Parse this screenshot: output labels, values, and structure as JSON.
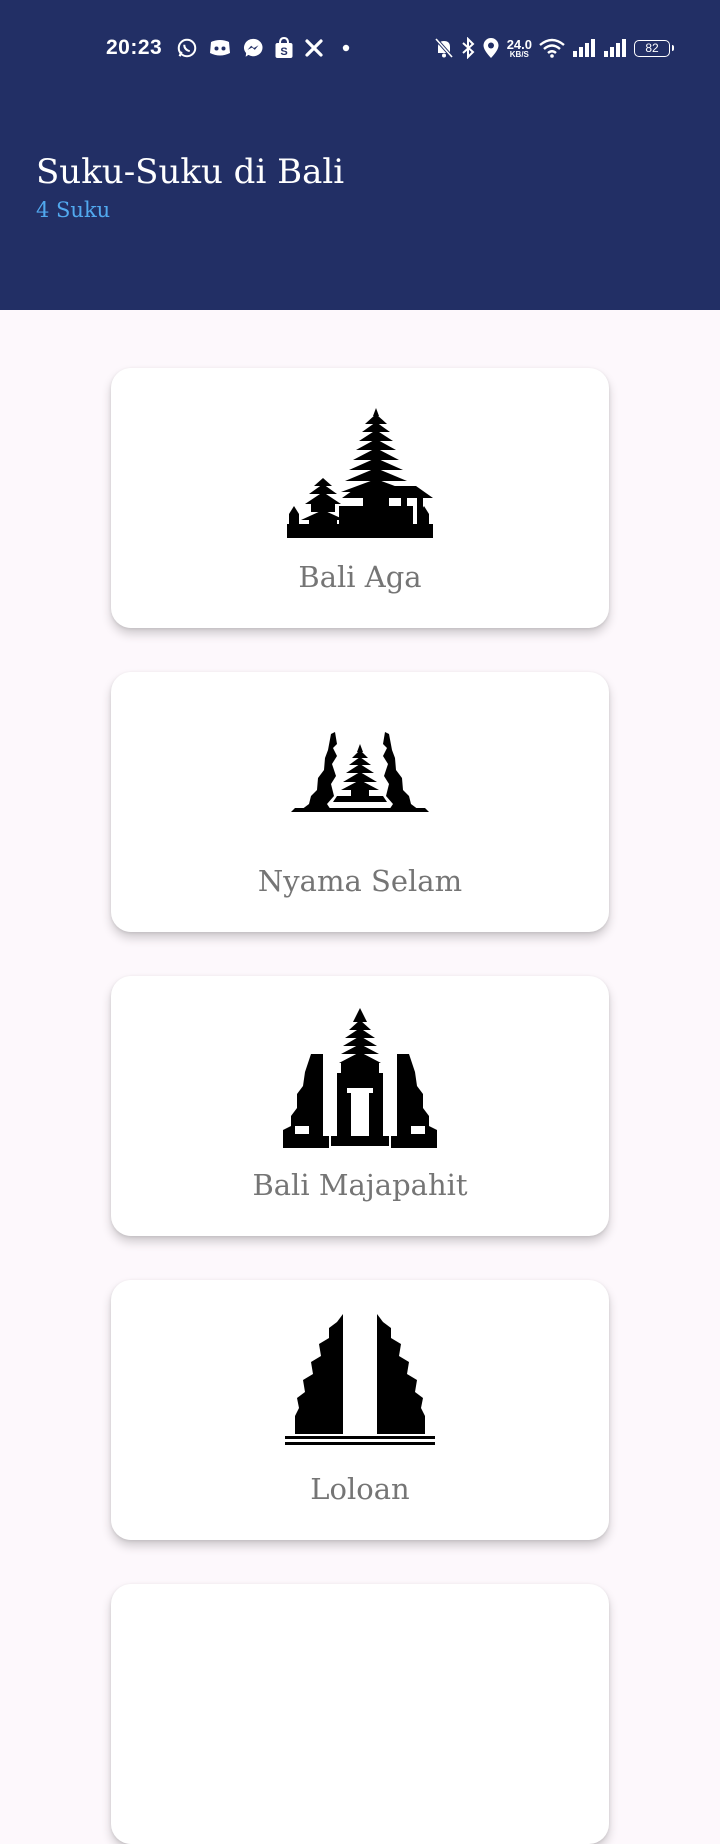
{
  "status_bar": {
    "time": "20:23",
    "network_speed_value": "24.0",
    "network_speed_unit": "KB/S",
    "battery_level": "82",
    "left_icons": [
      "whatsapp-icon",
      "discord-icon",
      "messenger-icon",
      "shopee-icon",
      "x-app-icon",
      "dot-icon"
    ],
    "right_icons": [
      "mute-icon",
      "bluetooth-icon",
      "location-icon",
      "wifi-icon",
      "signal-icon",
      "signal-icon",
      "battery-icon"
    ]
  },
  "app_bar": {
    "title": "Suku-Suku di Bali",
    "subtitle": "4 Suku",
    "background_color": "#222f65",
    "subtitle_color": "#51a9ef"
  },
  "items": [
    {
      "label": "Bali Aga",
      "icon": "temple-pagoda-icon"
    },
    {
      "label": "Nyama Selam",
      "icon": "temple-split-gate-icon"
    },
    {
      "label": "Bali Majapahit",
      "icon": "temple-gate-icon"
    },
    {
      "label": "Loloan",
      "icon": "candi-bentar-icon"
    }
  ]
}
